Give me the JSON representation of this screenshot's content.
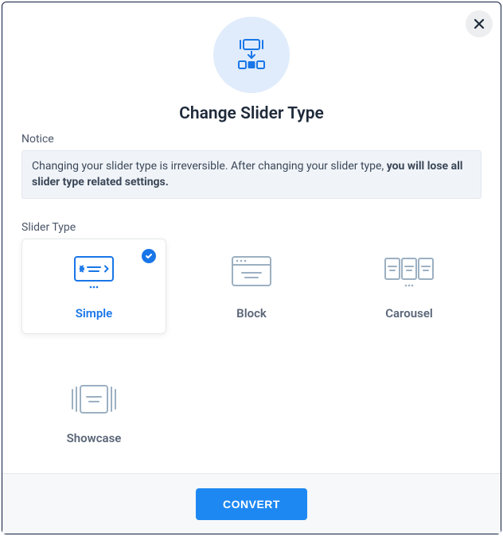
{
  "title": "Change Slider Type",
  "notice": {
    "label": "Notice",
    "text_normal": "Changing your slider type is irreversible. After changing your slider type, ",
    "text_bold": "you will lose all slider type related settings."
  },
  "slider_type": {
    "label": "Slider Type",
    "options": {
      "simple": "Simple",
      "block": "Block",
      "carousel": "Carousel",
      "showcase": "Showcase"
    }
  },
  "footer": {
    "convert_label": "CONVERT"
  }
}
